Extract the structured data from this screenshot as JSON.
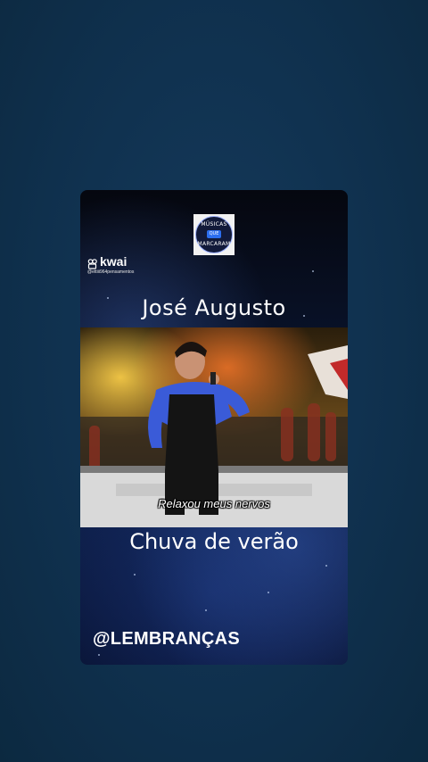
{
  "logo": {
    "top_text": "MÚSICAS",
    "middle_text": "QUE",
    "bottom_text": "MARCARAM"
  },
  "kwai": {
    "icon": "kwai-camera-icon",
    "name": "kwai",
    "handle": "@ettiii964pensamentos"
  },
  "post": {
    "artist": "José Augusto",
    "lyric_subtitle": "Relaxou meus nervos",
    "song": "Chuva de verão",
    "account": "@LEMBRANÇAS"
  },
  "colors": {
    "page_background": "#0f304d",
    "card_background": "#0a1530",
    "text": "#ffffff"
  }
}
